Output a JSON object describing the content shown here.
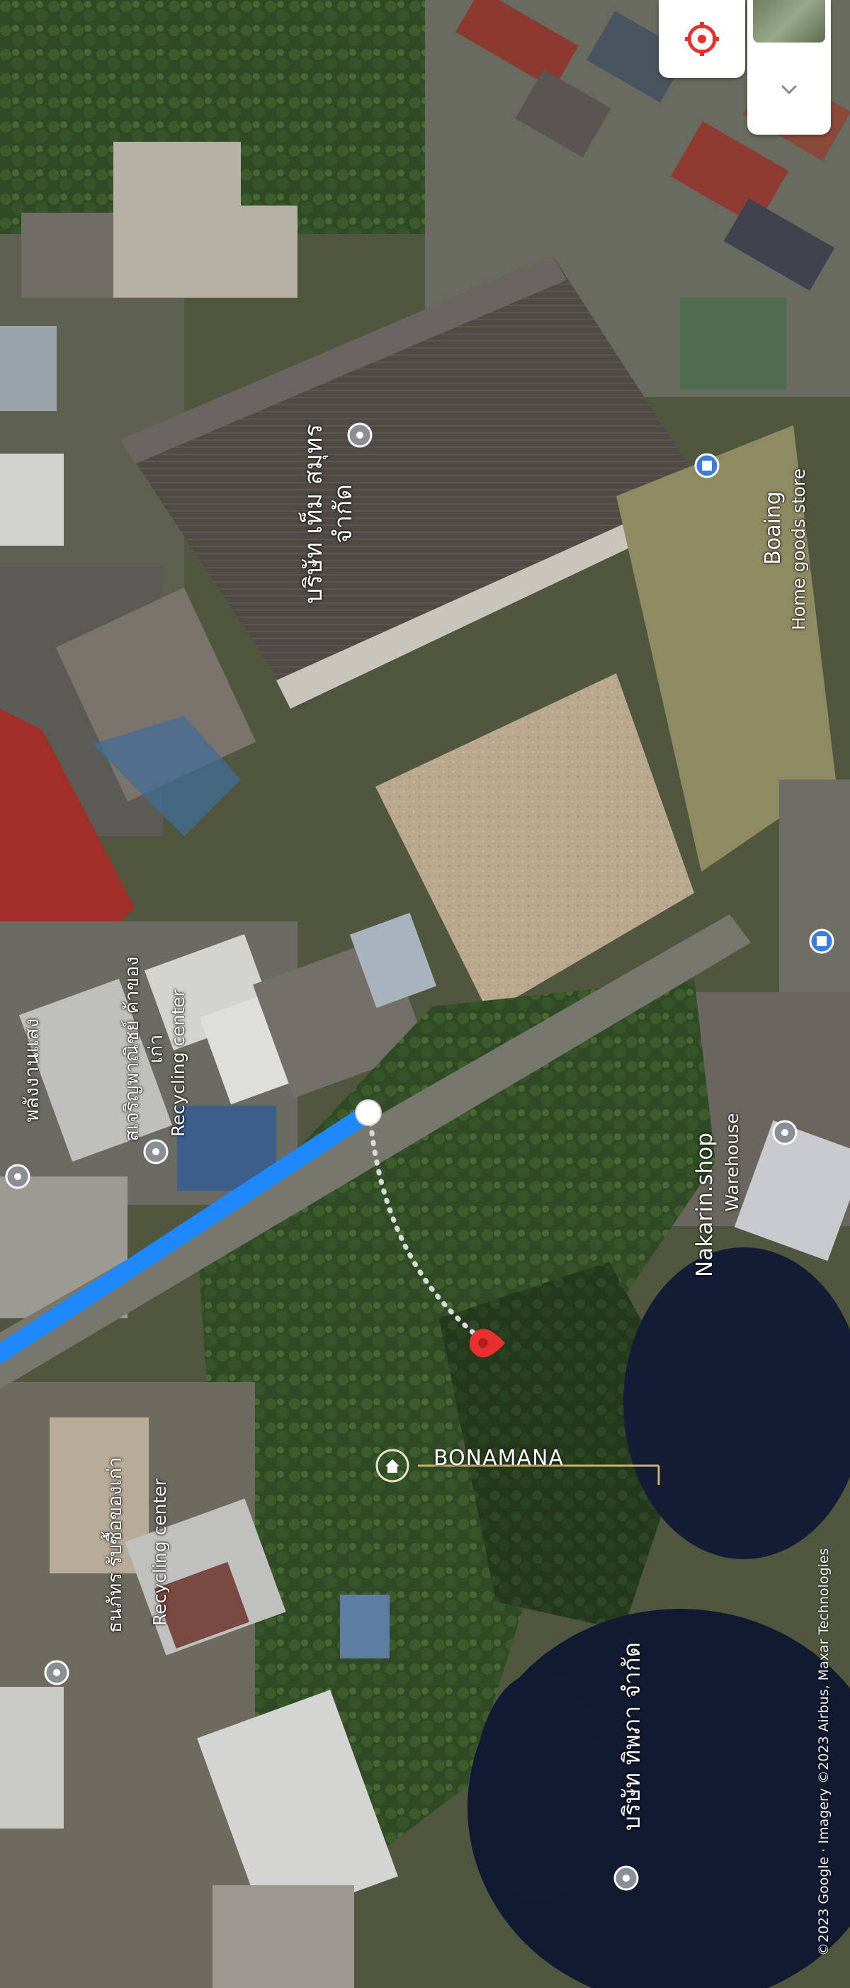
{
  "map": {
    "orientation": "rotated 90 degrees (labels read bottom-to-top)",
    "labels": {
      "company_top": "บริษัท เท็ม สมุทร จำกัด",
      "boaing_name": "Boaing",
      "boaing_category": "Home goods store",
      "left_place_1": "พลังงานแสง",
      "recycle_1_name": "สเจริญพาณิชย์ ค้าของเก่า",
      "recycle_1_category": "Recycling center",
      "nakarin_name": "Nakarin.shop",
      "nakarin_category": "Warehouse",
      "bonamana": "BONAMANA",
      "recycle_2_name": "ธนภัทร รับซื้อของเก่า",
      "recycle_2_category": "Recycling center",
      "company_bottom": "บริษัท ทิพภา จำกัด",
      "attribution": "©2023 Google · Imagery ©2023 Airbus, Maxar Technologies"
    },
    "colors": {
      "route": "#1e88ff",
      "pin": "#e8302e",
      "label_white": "#ffffff"
    },
    "icons": {
      "compass": "compass-icon",
      "layers_toggle": "chevron-down-icon",
      "pin": "location-pin-icon",
      "home": "home-icon",
      "poi": "place-marker-icon"
    }
  }
}
